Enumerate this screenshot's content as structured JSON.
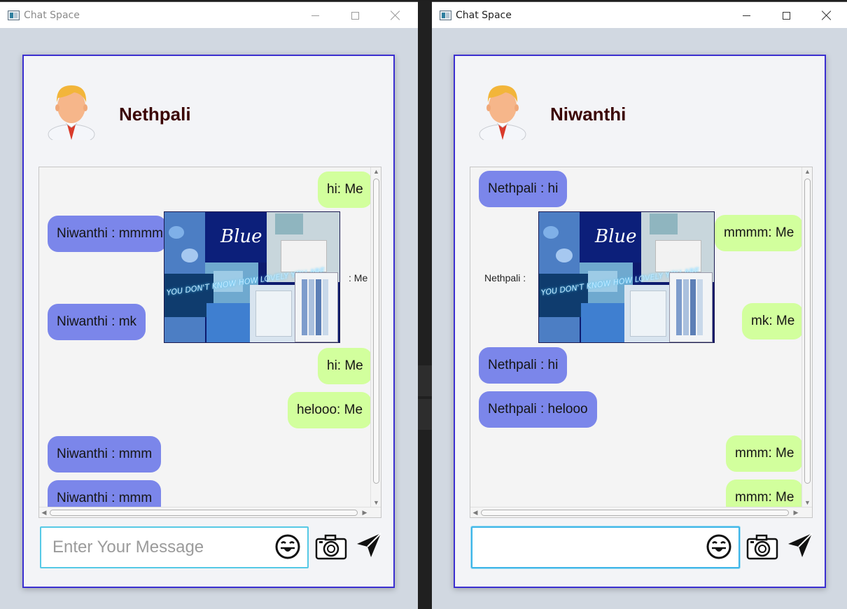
{
  "colors": {
    "my_bubble": "#d2ff9d",
    "their_bubble": "#7b86ea",
    "card_border": "#3b2fd0",
    "input_border": "#56c9e6",
    "name_color": "#3b0505"
  },
  "icons": {
    "app": "app-window-icon",
    "avatar": "user-avatar-icon",
    "emoji": "smiley-tongue-icon",
    "camera": "camera-icon",
    "send": "paper-plane-icon"
  },
  "windows": [
    {
      "title": "Chat Space",
      "contact_name": "Nethpali",
      "messages": [
        {
          "text": "hi: Me"
        },
        {
          "text": "Niwanthi : mmmm"
        },
        {
          "text": ": Me"
        },
        {
          "text": "Niwanthi : mk"
        },
        {
          "text": "hi: Me"
        },
        {
          "text": "helooo: Me"
        },
        {
          "text": "Niwanthi : mmm"
        },
        {
          "text": "Niwanthi : mmm"
        }
      ],
      "image_caption": "Blue",
      "image_neon_text": "YOU DON'T KNOW HOW LOVELY YOU ARE",
      "input": {
        "value": "",
        "placeholder": "Enter Your Message"
      }
    },
    {
      "title": "Chat Space",
      "contact_name": "Niwanthi",
      "messages": [
        {
          "text": "Nethpali : hi"
        },
        {
          "text": "mmmm: Me"
        },
        {
          "text": "Nethpali :"
        },
        {
          "text": "mk: Me"
        },
        {
          "text": "Nethpali : hi"
        },
        {
          "text": "Nethpali : helooo"
        },
        {
          "text": "mmm: Me"
        },
        {
          "text": "mmm: Me"
        }
      ],
      "image_caption": "Blue",
      "image_neon_text": "YOU DON'T KNOW HOW LOVELY YOU ARE",
      "input": {
        "value": "",
        "placeholder": ""
      }
    }
  ]
}
